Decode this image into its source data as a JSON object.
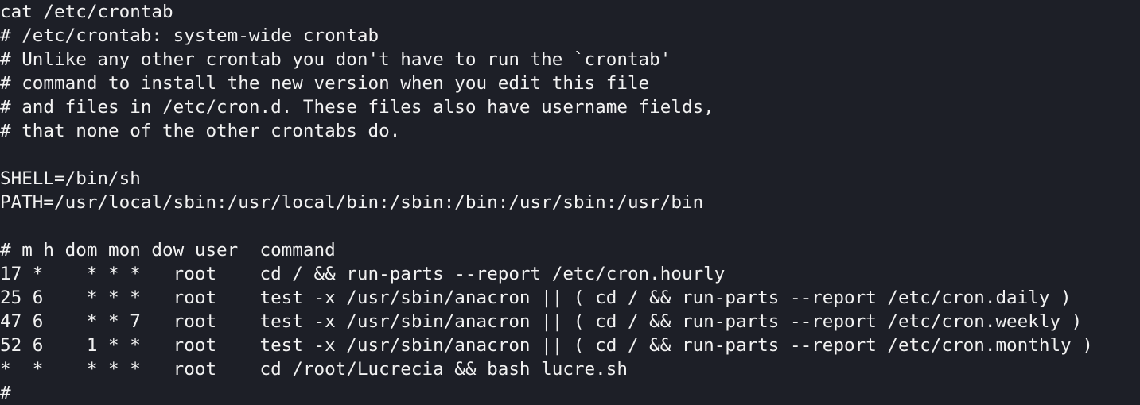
{
  "terminal": {
    "lines": [
      "cat /etc/crontab",
      "# /etc/crontab: system-wide crontab",
      "# Unlike any other crontab you don't have to run the `crontab'",
      "# command to install the new version when you edit this file",
      "# and files in /etc/cron.d. These files also have username fields,",
      "# that none of the other crontabs do.",
      "",
      "SHELL=/bin/sh",
      "PATH=/usr/local/sbin:/usr/local/bin:/sbin:/bin:/usr/sbin:/usr/bin",
      "",
      "# m h dom mon dow user  command",
      "17 *    * * *   root    cd / && run-parts --report /etc/cron.hourly",
      "25 6    * * *   root    test -x /usr/sbin/anacron || ( cd / && run-parts --report /etc/cron.daily )",
      "47 6    * * 7   root    test -x /usr/sbin/anacron || ( cd / && run-parts --report /etc/cron.weekly )",
      "52 6    1 * *   root    test -x /usr/sbin/anacron || ( cd / && run-parts --report /etc/cron.monthly )",
      "*  *    * * *   root    cd /root/Lucrecia && bash lucre.sh",
      "#"
    ]
  }
}
